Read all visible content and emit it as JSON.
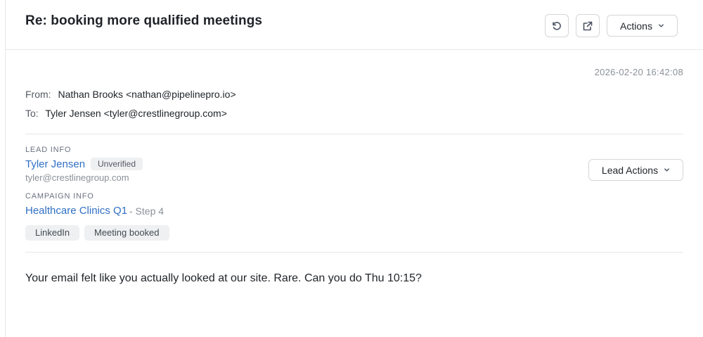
{
  "email": {
    "subject": "Re: booking more qualified meetings",
    "timestamp": "2026-02-20 16:42:08",
    "from_label": "From:",
    "from_value": "Nathan Brooks <nathan@pipelinepro.io>",
    "to_label": "To:",
    "to_value": "Tyler Jensen <tyler@crestlinegroup.com>",
    "body": "Your email felt like you actually looked at our site. Rare. Can you do Thu 10:15?"
  },
  "toolbar": {
    "undo_icon": "undo-icon",
    "open_icon": "external-link-icon",
    "actions_label": "Actions"
  },
  "lead": {
    "section_label": "LEAD INFO",
    "name": "Tyler Jensen",
    "status": "Unverified",
    "email": "tyler@crestlinegroup.com",
    "actions_label": "Lead Actions"
  },
  "campaign": {
    "section_label": "CAMPAIGN INFO",
    "name": "Healthcare Clinics Q1",
    "step": "- Step 4"
  },
  "tags": [
    "LinkedIn",
    "Meeting booked"
  ],
  "colors": {
    "link": "#2f6fc4",
    "border": "#e5e7eb",
    "badge_bg": "#eef0f2"
  }
}
